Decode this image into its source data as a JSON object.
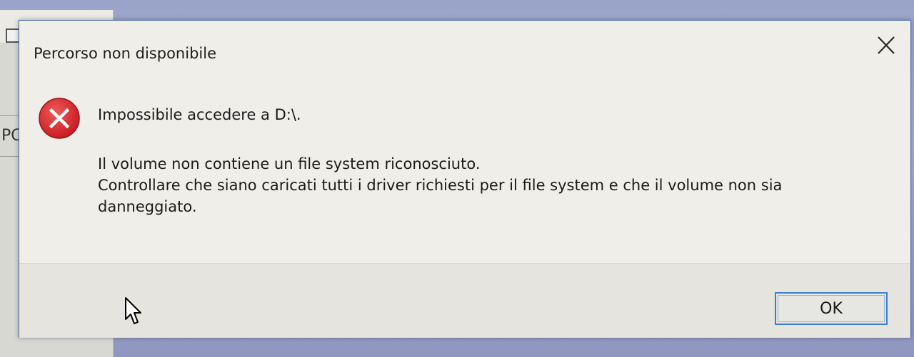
{
  "background_window": {
    "partial_label": "PC"
  },
  "dialog": {
    "title": "Percorso non disponibile",
    "close_icon": "close-icon",
    "error_icon": "error-icon",
    "main_instruction": "Impossibile accedere a D:\\.",
    "message_lines": [
      "Il volume non contiene un file system riconosciuto.",
      "Controllare che siano caricati tutti i driver richiesti per il file system e che il volume non sia",
      "danneggiato."
    ],
    "ok_label": "OK"
  },
  "colors": {
    "error_red": "#d9262b",
    "focus_blue": "#3c7fd0",
    "dialog_background": "#efeee9"
  }
}
